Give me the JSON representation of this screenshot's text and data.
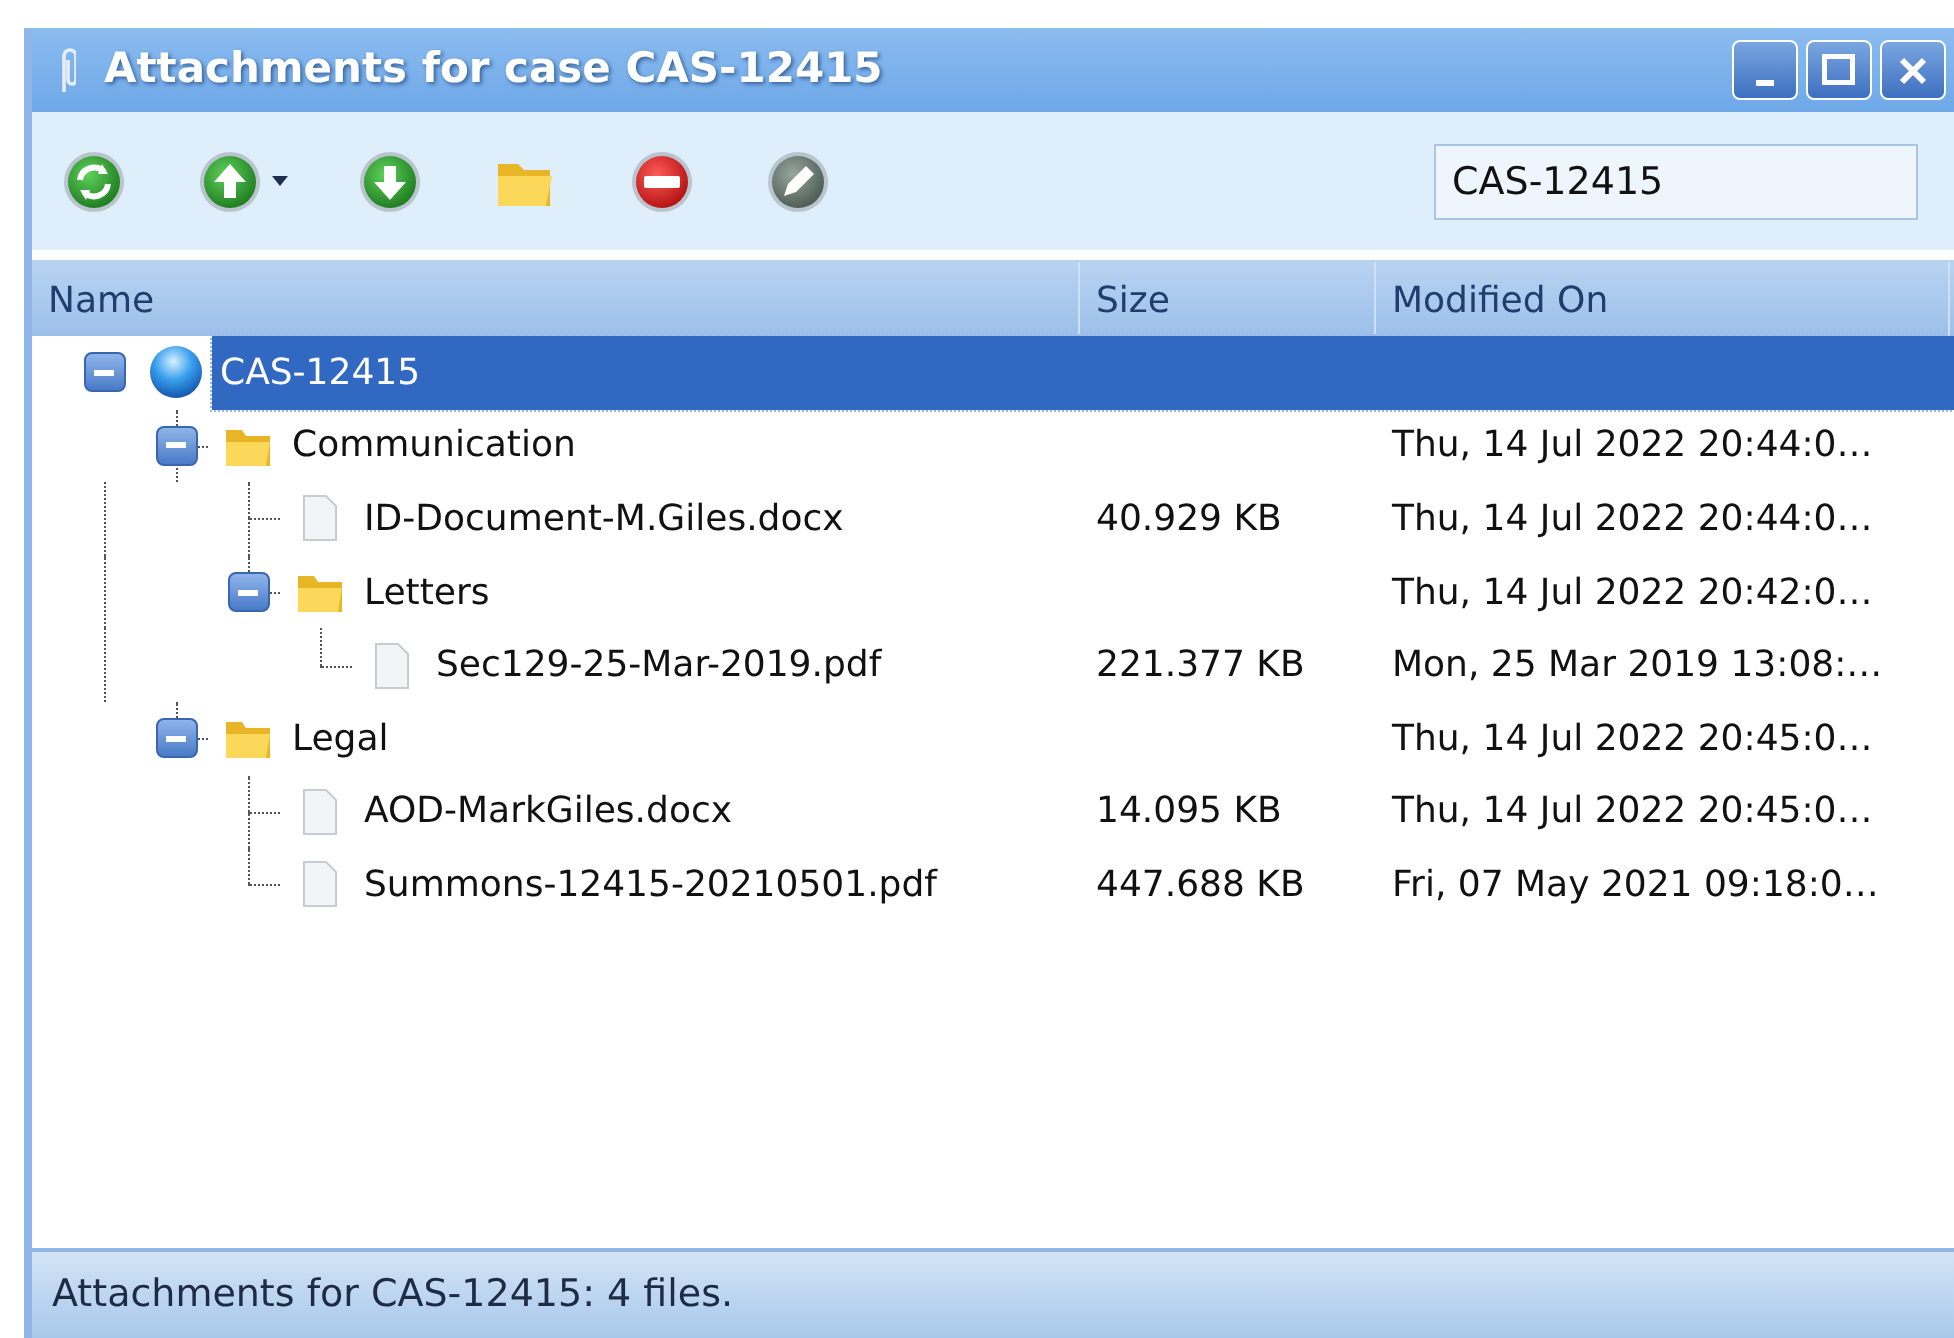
{
  "window": {
    "title": "Attachments for case CAS-12415"
  },
  "toolbar": {
    "buttons": [
      {
        "kind": "refresh",
        "dropdown": false
      },
      {
        "kind": "upload",
        "dropdown": true
      },
      {
        "kind": "download",
        "dropdown": false
      },
      {
        "kind": "folder",
        "dropdown": false
      },
      {
        "kind": "delete",
        "dropdown": false
      },
      {
        "kind": "edit",
        "dropdown": false
      }
    ],
    "search": {
      "value": "CAS-12415"
    }
  },
  "table": {
    "columns": [
      "Name",
      "Size",
      "Modified On"
    ],
    "rows": [
      {
        "kind": "case",
        "name": "CAS-12415",
        "selected": true,
        "expanded": true,
        "children": [
          {
            "kind": "folder",
            "name": "Communication",
            "modified": "Thu, 14 Jul 2022 20:44:0…",
            "selected": false,
            "expanded": true,
            "children": [
              {
                "kind": "file",
                "name": "ID-Document-M.Giles.docx",
                "size": "40.929 KB",
                "modified": "Thu, 14 Jul 2022 20:44:0…",
                "selected": false
              },
              {
                "kind": "folder",
                "name": "Letters",
                "modified": "Thu, 14 Jul 2022 20:42:0…",
                "selected": false,
                "expanded": true,
                "children": [
                  {
                    "kind": "file",
                    "name": "Sec129-25-Mar-2019.pdf",
                    "size": "221.377 KB",
                    "modified": "Mon, 25 Mar 2019 13:08:…",
                    "selected": false
                  }
                ]
              }
            ]
          },
          {
            "kind": "folder",
            "name": "Legal",
            "modified": "Thu, 14 Jul 2022 20:45:0…",
            "selected": false,
            "expanded": true,
            "children": [
              {
                "kind": "file",
                "name": "AOD-MarkGiles.docx",
                "size": "14.095 KB",
                "modified": "Thu, 14 Jul 2022 20:45:0…",
                "selected": false
              },
              {
                "kind": "file",
                "name": "Summons-12415-20210501.pdf",
                "size": "447.688 KB",
                "modified": "Fri, 07 May 2021 09:18:0…",
                "selected": false
              }
            ]
          }
        ]
      }
    ]
  },
  "status_bar": "Attachments for CAS-12415: 4 files."
}
